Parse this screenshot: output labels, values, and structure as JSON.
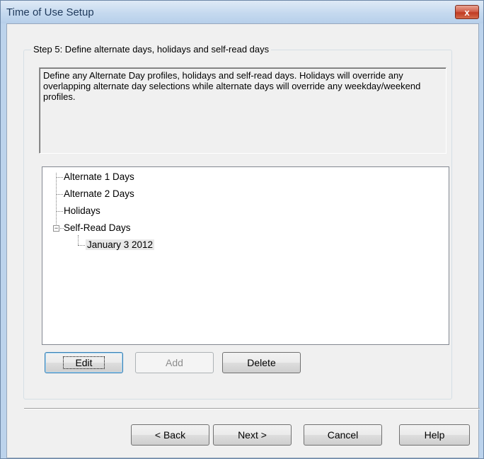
{
  "window": {
    "title": "Time of Use Setup",
    "close_label": "x",
    "accent_color": "#c03a22"
  },
  "group": {
    "legend": "Step 5: Define alternate days, holidays and self-read days"
  },
  "description": "Define any Alternate Day profiles, holidays and self-read days.  Holidays will override any overlapping alternate day selections while alternate days will override any weekday/weekend profiles.",
  "tree": {
    "items": [
      {
        "label": "Alternate 1 Days"
      },
      {
        "label": "Alternate 2 Days"
      },
      {
        "label": "Holidays"
      },
      {
        "label": "Self-Read Days",
        "expanded": true,
        "expander_symbol": "−"
      },
      {
        "label": "January 3 2012",
        "selected": true
      }
    ]
  },
  "actions": {
    "edit": "Edit",
    "add": "Add",
    "delete": "Delete"
  },
  "nav": {
    "back": "< Back",
    "next": "Next >",
    "cancel": "Cancel",
    "help": "Help"
  }
}
